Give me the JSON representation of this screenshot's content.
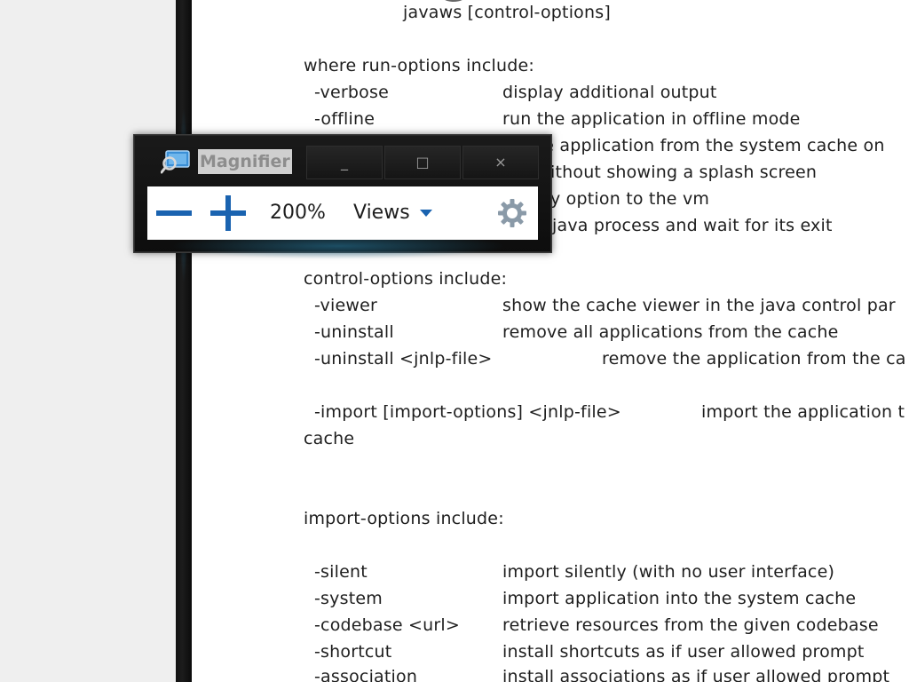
{
  "document": {
    "lines": [
      "javaws [control-options]",
      "where run-options include:",
      "-verbose",
      "display additional output",
      "-offline",
      "run the application in offline mode",
      "he application from the system cache on",
      "ithout showing a splash screen",
      "y option to the vm",
      "java process and wait for its exit",
      "control-options include:",
      "-viewer",
      "show the cache viewer in the java control par",
      "-uninstall",
      "remove all applications from the cache",
      "-uninstall <jnlp-file>",
      "remove the application from the ca",
      "-import [import-options] <jnlp-file>",
      "import the application t",
      "cache",
      "import-options include:",
      "-silent",
      "import silently (with no user interface)",
      "-system",
      "import application into the system cache",
      "-codebase <url>",
      "retrieve resources from the given codebase",
      "-shortcut",
      "install shortcuts as if user allowed prompt",
      "-association",
      "install associations as if user allowed prompt"
    ]
  },
  "magnifier": {
    "title": "Magnifier",
    "minimize_glyph": "_",
    "maximize_glyph": "□",
    "close_glyph": "×",
    "zoom_level": "200%",
    "views_label": "Views",
    "icons": {
      "app": "magnifier-app-icon",
      "zoom_out": "minus-icon",
      "zoom_in": "plus-icon",
      "views_dropdown": "triangle-down-icon",
      "settings": "gear-icon"
    },
    "accent_color": "#1a63b0"
  }
}
